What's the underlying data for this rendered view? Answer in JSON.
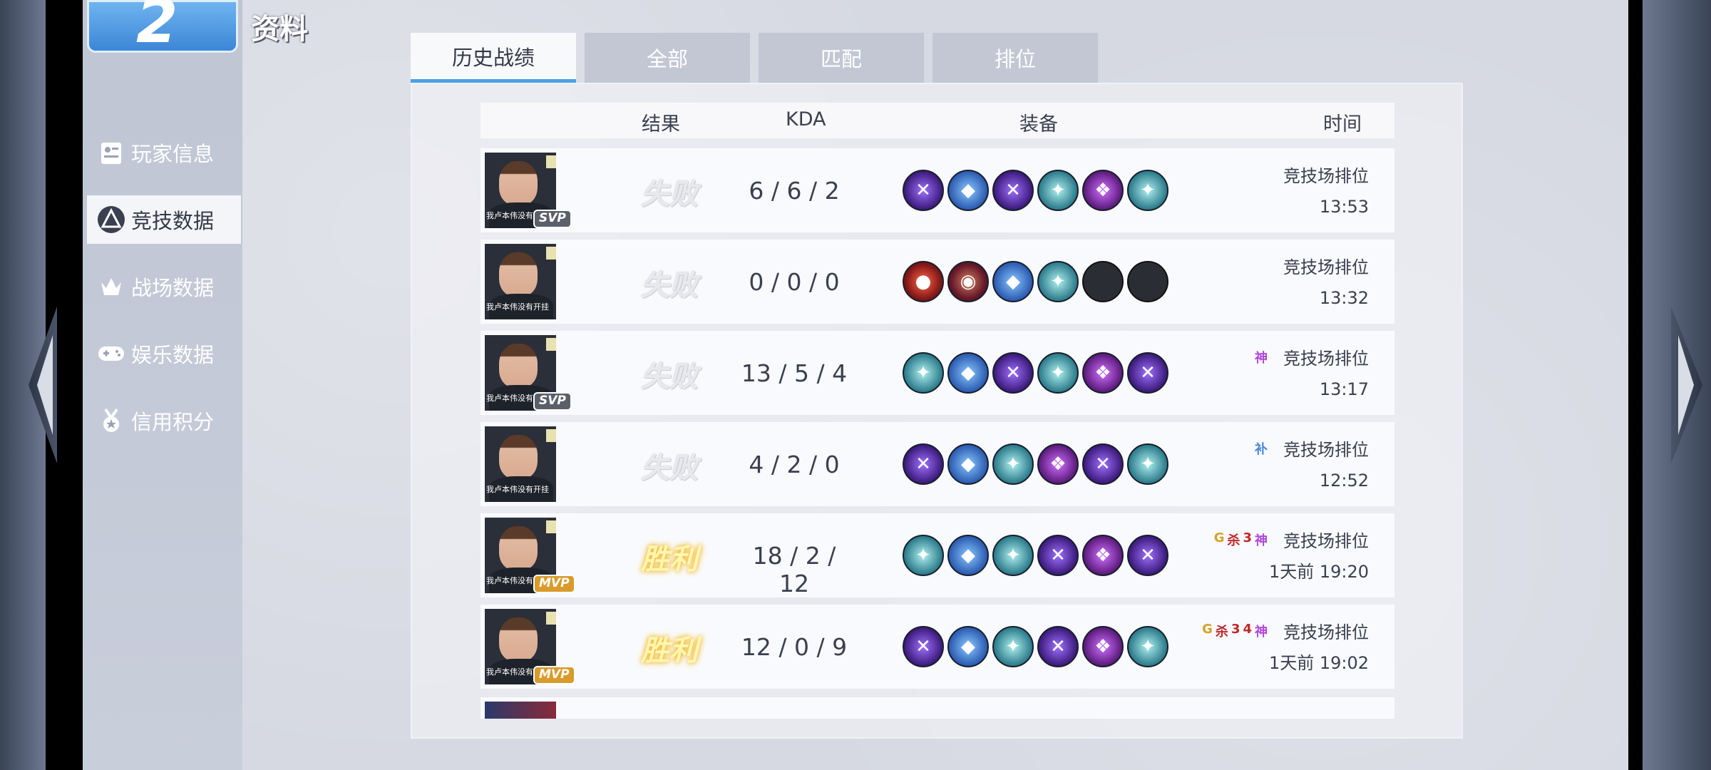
{
  "header": {
    "brand_number": "2",
    "title": "资料"
  },
  "sidebar": {
    "items": [
      {
        "label": "玩家信息",
        "icon": "profile-card-icon",
        "active": false
      },
      {
        "label": "竞技数据",
        "icon": "competitive-emblem-icon",
        "active": true
      },
      {
        "label": "战场数据",
        "icon": "battlefield-crown-icon",
        "active": false
      },
      {
        "label": "娱乐数据",
        "icon": "gamepad-icon",
        "active": false
      },
      {
        "label": "信用积分",
        "icon": "medal-icon",
        "active": false
      }
    ]
  },
  "tabs": [
    {
      "label": "历史战绩",
      "active": true
    },
    {
      "label": "全部",
      "active": false
    },
    {
      "label": "匹配",
      "active": false
    },
    {
      "label": "排位",
      "active": false
    }
  ],
  "table": {
    "headers": {
      "result": "结果",
      "kda": "KDA",
      "items": "装备",
      "time": "时间"
    },
    "rows": [
      {
        "avatar_caption": "我卢本伟没有",
        "badge": "SVP",
        "result": "失败",
        "win": false,
        "kda": "6 / 6 / 2",
        "items": [
          "purple",
          "blue",
          "purple",
          "teal",
          "magenta",
          "teal"
        ],
        "tags": [],
        "mode": "竞技场排位",
        "time": "13:53"
      },
      {
        "avatar_caption": "我卢本伟没有开挂",
        "badge": "",
        "result": "失败",
        "win": false,
        "kda": "0 / 0 / 0",
        "items": [
          "red",
          "crimson",
          "blue",
          "teal",
          "empty",
          "empty"
        ],
        "tags": [],
        "mode": "竞技场排位",
        "time": "13:32"
      },
      {
        "avatar_caption": "我卢本伟没有开挂",
        "badge": "SVP",
        "result": "失败",
        "win": false,
        "kda": "13 / 5 / 4",
        "items": [
          "teal",
          "blue",
          "purple",
          "teal",
          "magenta",
          "purple"
        ],
        "tags": [
          {
            "t": "神",
            "c": "p"
          }
        ],
        "mode": "竞技场排位",
        "time": "13:17"
      },
      {
        "avatar_caption": "我卢本伟没有开挂",
        "badge": "",
        "result": "失败",
        "win": false,
        "kda": "4 / 2 / 0",
        "items": [
          "purple",
          "blue",
          "teal",
          "magenta",
          "purple",
          "teal"
        ],
        "tags": [
          {
            "t": "补",
            "c": "b"
          }
        ],
        "mode": "竞技场排位",
        "time": "12:52"
      },
      {
        "avatar_caption": "我卢本伟没有开",
        "badge": "MVP",
        "result": "胜利",
        "win": true,
        "kda": "18 / 2 / 12",
        "items": [
          "teal",
          "blue",
          "teal",
          "purple",
          "magenta",
          "purple"
        ],
        "tags": [
          {
            "t": "G",
            "c": "g"
          },
          {
            "t": "杀",
            "c": "r"
          },
          {
            "t": "3",
            "c": "r"
          },
          {
            "t": "神",
            "c": "p"
          }
        ],
        "mode": "竞技场排位",
        "time": "1天前  19:20"
      },
      {
        "avatar_caption": "我卢本伟没有开",
        "badge": "MVP",
        "result": "胜利",
        "win": true,
        "kda": "12 / 0 / 9",
        "items": [
          "purple",
          "blue",
          "teal",
          "purple",
          "magenta",
          "teal"
        ],
        "tags": [
          {
            "t": "G",
            "c": "g"
          },
          {
            "t": "杀",
            "c": "r"
          },
          {
            "t": "3",
            "c": "r"
          },
          {
            "t": "4",
            "c": "r"
          },
          {
            "t": "神",
            "c": "p"
          }
        ],
        "mode": "竞技场排位",
        "time": "1天前  19:02"
      }
    ]
  },
  "item_glyphs": {
    "purple": "✕",
    "blue": "◆",
    "teal": "✦",
    "magenta": "❖",
    "red": "●",
    "crimson": "◉",
    "empty": ""
  }
}
